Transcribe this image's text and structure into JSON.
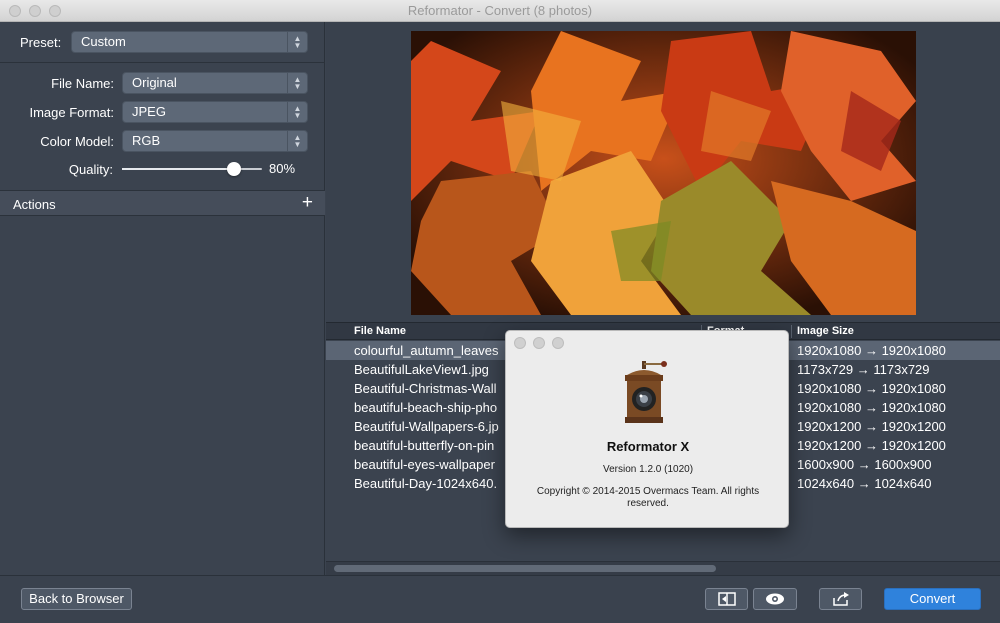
{
  "window": {
    "title": "Reformator - Convert (8 photos)"
  },
  "settings": {
    "preset_label": "Preset:",
    "preset_value": "Custom",
    "file_name_label": "File Name:",
    "file_name_value": "Original",
    "image_format_label": "Image Format:",
    "image_format_value": "JPEG",
    "color_model_label": "Color Model:",
    "color_model_value": "RGB",
    "quality_label": "Quality:",
    "quality_value": "80%",
    "quality_fraction": 0.8
  },
  "actions": {
    "label": "Actions",
    "add_icon": "+"
  },
  "file_list": {
    "col_file_name": "File Name",
    "col_format": "Format",
    "col_image_size": "Image Size",
    "rows": [
      {
        "name": "colourful_autumn_leaves",
        "size": "1920x1080 → 1920x1080",
        "selected": true
      },
      {
        "name": "BeautifulLakeView1.jpg",
        "size": "1173x729 → 1173x729",
        "selected": false
      },
      {
        "name": "Beautiful-Christmas-Wall",
        "size": "1920x1080 → 1920x1080",
        "selected": false
      },
      {
        "name": "beautiful-beach-ship-pho",
        "size": "1920x1080 → 1920x1080",
        "selected": false
      },
      {
        "name": "Beautiful-Wallpapers-6.jp",
        "size": "1920x1200 → 1920x1200",
        "selected": false
      },
      {
        "name": "beautiful-butterfly-on-pin",
        "size": "1920x1200 → 1920x1200",
        "selected": false
      },
      {
        "name": "beautiful-eyes-wallpaper",
        "size": "1600x900 → 1600x900",
        "selected": false
      },
      {
        "name": "Beautiful-Day-1024x640.",
        "size": "1024x640 → 1024x640",
        "selected": false
      }
    ]
  },
  "toolbar": {
    "back_label": "Back to Browser",
    "compare_icon": "compare-icon",
    "preview_icon": "eye-icon",
    "share_icon": "share-icon",
    "convert_label": "Convert"
  },
  "about": {
    "app_name": "Reformator X",
    "version": "Version 1.2.0 (1020)",
    "copyright": "Copyright © 2014-2015 Overmacs Team. All rights reserved."
  },
  "colors": {
    "accent": "#2f82dc",
    "panel": "#3b434f",
    "selection": "#5b6574"
  }
}
